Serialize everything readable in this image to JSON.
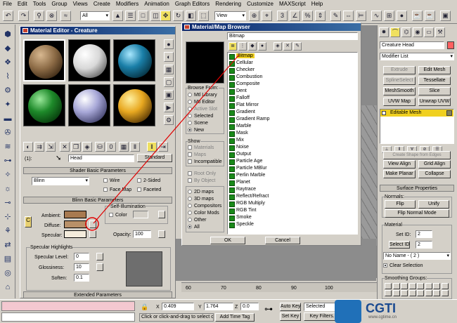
{
  "menu": [
    "File",
    "Edit",
    "Tools",
    "Group",
    "Views",
    "Create",
    "Modifiers",
    "Animation",
    "Graph Editors",
    "Rendering",
    "Customize",
    "MAXScript",
    "Help"
  ],
  "toolbar": {
    "selection_filter": "All",
    "coord_system": "View"
  },
  "material_editor": {
    "title": "Material Editor - Creature",
    "material_name": "Head",
    "material_type": "Standard",
    "slot_label": "(1):",
    "spheres": [
      "#8b6a45",
      "#e8e8e8",
      "#1a7fa8",
      "#1e8a2a",
      "#a8a8d8",
      "#e8a820"
    ],
    "shader_rollout": "Shader Basic Parameters",
    "shader_type": "Blinn",
    "wire": "Wire",
    "two_sided": "2-Sided",
    "face_map": "Face Map",
    "faceted": "Faceted",
    "blinn_rollout": "Blinn Basic Parameters",
    "self_illum": "Self-Illumination",
    "color": "Color",
    "ambient": "Ambient:",
    "diffuse": "Diffuse:",
    "specular": "Specular:",
    "ambient_color": "#a87a50",
    "diffuse_color": "#b89068",
    "specular_color": "#f4ecdc",
    "opacity_label": "Opacity:",
    "opacity": "100",
    "spec_highlights": "Specular Highlights",
    "spec_level_label": "Specular Level:",
    "spec_level": "0",
    "glossiness_label": "Glossiness:",
    "glossiness": "10",
    "soften_label": "Soften:",
    "soften": "0.1",
    "extended": "Extended Parameters",
    "lock_icon": "C"
  },
  "browser": {
    "title": "Material/Map Browser",
    "search": "Bitmap",
    "browse_from_title": "Browse From:",
    "browse_from": [
      "Mtl Library",
      "Mtl Editor",
      "Active Slot",
      "Selected",
      "Scene",
      "New"
    ],
    "show_title": "Show",
    "show": [
      "Materials",
      "Maps",
      "Incompatible"
    ],
    "root_only": "Root Only",
    "by_object": "By Object",
    "filters": [
      "2D maps",
      "3D maps",
      "Compositors",
      "Color Mods",
      "Other",
      "All"
    ],
    "items": [
      "Bitmap",
      "Cellular",
      "Checker",
      "Combustion",
      "Composite",
      "Dent",
      "Falloff",
      "Flat Mirror",
      "Gradient",
      "Gradient Ramp",
      "Marble",
      "Mask",
      "Mix",
      "Noise",
      "Output",
      "Particle Age",
      "Particle MBlur",
      "Perlin Marble",
      "Planet",
      "Raytrace",
      "Reflect/Refract",
      "RGB Multiply",
      "RGB Tint",
      "Smoke",
      "Speckle"
    ],
    "ok": "OK",
    "cancel": "Cancel"
  },
  "command_panel": {
    "object_name": "Creature Head",
    "modifier_list": "Modifier List",
    "buttons": [
      "Extrude",
      "Edit Mesh",
      "SplineSelect",
      "Tessellate",
      "MeshSmooth",
      "Slice",
      "UVW Map",
      "Unwrap UVW"
    ],
    "stack_item": "Editable Mesh",
    "create_shape": "Create Shape from Edges",
    "view_align": "View Align",
    "grid_align": "Grid Align",
    "make_planar": "Make Planar",
    "collapse": "Collapse",
    "surface_props": "Surface Properties",
    "normals": "Normals:",
    "flip": "Flip",
    "unify": "Unify",
    "flip_normal_mode": "Flip Normal Mode",
    "material": "Material",
    "set_id_label": "Set ID:",
    "set_id": "2",
    "select_id_label": "Select ID",
    "select_id": "2",
    "no_name": "No Name - ( 2 )",
    "clear_selection": "Clear Selection",
    "smoothing_groups": "Smoothing Groups:"
  },
  "status": {
    "x_label": "X",
    "x": "0.409",
    "y_label": "Y",
    "y": "1.764",
    "z_label": "Z",
    "z": "0.0",
    "prompt": "Click or click-and-drag to select ob",
    "add_time_tag": "Add Time Tag",
    "auto_key": "Auto Key",
    "selected": "Selected",
    "set_key": "Set Key",
    "key_filters": "Key Filters..."
  },
  "timeline": {
    "ticks": [
      "60",
      "70",
      "80",
      "90",
      "100"
    ]
  },
  "watermark": {
    "logo_text": "CGTI",
    "site": "www.cgtime.cn"
  }
}
